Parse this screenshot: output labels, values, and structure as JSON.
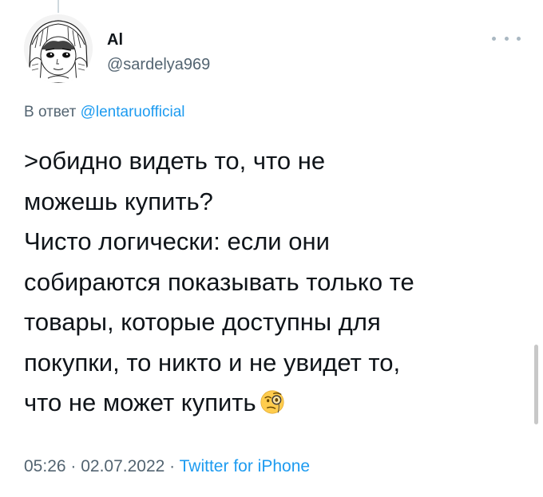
{
  "author": {
    "name": "Al",
    "handle": "@sardelya969"
  },
  "reply": {
    "prefix": "В ответ",
    "mention": "@lentaruofficial"
  },
  "tweet": {
    "text": ">обидно видеть то, что не\nможешь купить?\nЧисто логически: если они\nсобираются показывать только те\nтовары, которые доступны для\nпокупки, то никто и не увидет то,\nчто не может купить",
    "emoji_icon": "face-with-monocle-icon"
  },
  "meta": {
    "time": "05:26",
    "separator1": " · ",
    "date": "02.07.2022",
    "separator2": " · ",
    "source": "Twitter for iPhone"
  },
  "colors": {
    "text": "#0f1419",
    "secondary": "#536471",
    "link": "#1d9bf0",
    "thread_line": "#cfd9de"
  }
}
